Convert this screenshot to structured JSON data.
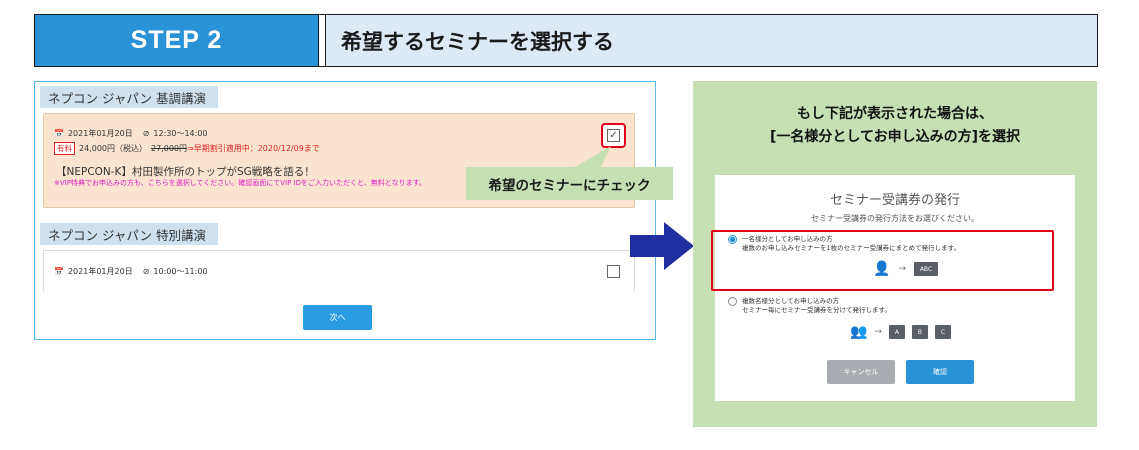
{
  "header": {
    "step_label": "STEP 2",
    "title": "希望するセミナーを選択する"
  },
  "left": {
    "keynote_label": "ネプコン ジャパン 基調講演",
    "keynote": {
      "date": "2021年01月20日",
      "time": "12:30～14:00",
      "paid_badge": "有料",
      "price": "24,000円（税込）",
      "original_price": "27,000円",
      "discount_note": "⇒早期割引適用中：2020/12/09まで",
      "session_title": "【NEPCON-K】村田製作所のトップがSG戦略を語る！",
      "vip_note": "※VIP特典でお申込みの方も、こちらを選択してください。確認画面にてVIP IDをご入力いただくと、無料となります。"
    },
    "callout": "希望のセミナーにチェック",
    "special_label": "ネプコン ジャパン 特別講演",
    "special": {
      "date": "2021年01月20日",
      "time": "10:00～11:00"
    },
    "next_button": "次へ"
  },
  "right": {
    "notice_line1": "もし下記が表示された場合は、",
    "notice_line2": "[一名様分としてお申し込みの方]を選択",
    "dialog": {
      "title": "セミナー受講券の発行",
      "subtitle": "セミナー受講券の発行方法をお選びください。",
      "option1_label": "一名様分としてお申し込みの方",
      "option1_desc": "複数のお申し込みセミナーを1枚のセミナー受講券にまとめて発行します。",
      "option1_ticket": "ABC",
      "option2_label": "複数名様分としてお申し込みの方",
      "option2_desc": "セミナー毎にセミナー受講券を分けて発行します。",
      "option2_tickets": [
        "A",
        "B",
        "C"
      ],
      "cancel_button": "キャンセル",
      "confirm_button": "確認"
    }
  },
  "colors": {
    "step_blue": "#2a93d8",
    "header_bg": "#dde9f6",
    "highlight_red": "#e4001b",
    "callout_green": "#c6e0b4",
    "arrow_navy": "#1f2fa0",
    "card_peach": "#fbe4cf"
  },
  "icons": [
    "calendar-icon",
    "clock-icon",
    "checkbox-checked-icon",
    "checkbox-empty-icon",
    "person-icon",
    "people-icon",
    "arrow-right-icon",
    "ticket-icon"
  ]
}
